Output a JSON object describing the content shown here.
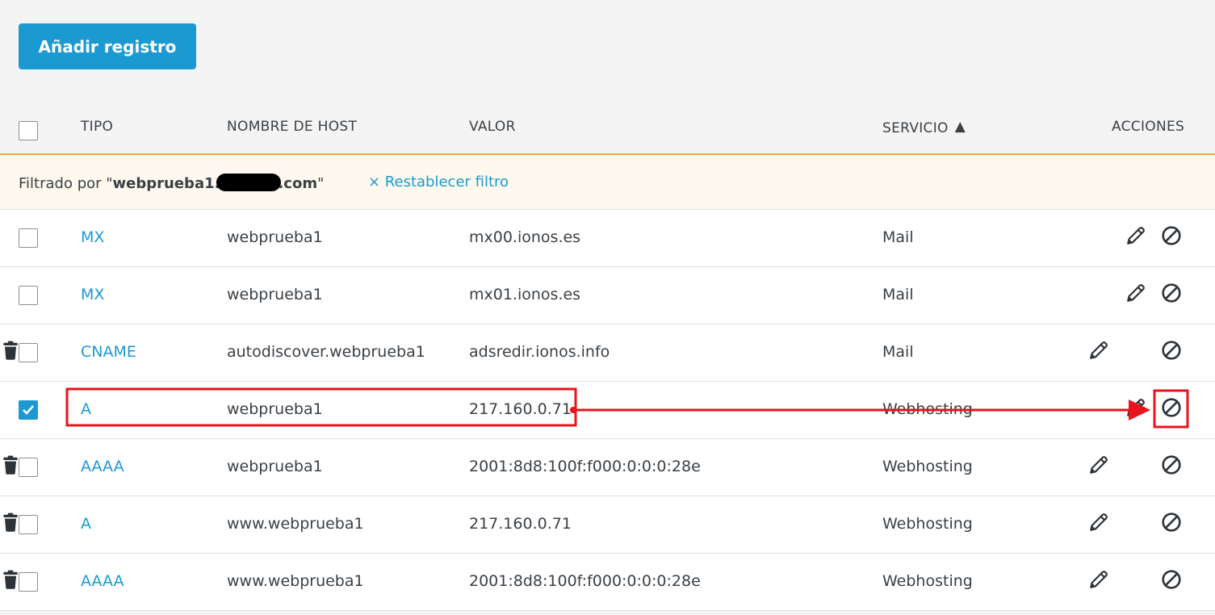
{
  "toolbar": {
    "add_label": "Añadir registro"
  },
  "table": {
    "headers": {
      "type": "TIPO",
      "host": "NOMBRE DE HOST",
      "value": "VALOR",
      "service": "SERVICIO",
      "service_sort_indicator": "▲",
      "actions": "ACCIONES"
    },
    "filter": {
      "prefix": "Filtrado por \"",
      "domain_start": "webprueba1.",
      "domain_end": ".com",
      "suffix": "\"",
      "reset_label": "× Restablecer filtro"
    },
    "rows": [
      {
        "checked": false,
        "type": "MX",
        "host": "webprueba1",
        "value": "mx00.ionos.es",
        "service": "Mail",
        "actions": [
          "edit",
          "disable"
        ]
      },
      {
        "checked": false,
        "type": "MX",
        "host": "webprueba1",
        "value": "mx01.ionos.es",
        "service": "Mail",
        "actions": [
          "edit",
          "disable"
        ]
      },
      {
        "checked": false,
        "type": "CNAME",
        "host": "autodiscover.webprueba1",
        "value": "adsredir.ionos.info",
        "service": "Mail",
        "actions": [
          "edit",
          "delete",
          "disable"
        ]
      },
      {
        "checked": true,
        "type": "A",
        "host": "webprueba1",
        "value": "217.160.0.71",
        "service": "Webhosting",
        "actions": [
          "edit",
          "disable"
        ]
      },
      {
        "checked": false,
        "type": "AAAA",
        "host": "webprueba1",
        "value": "2001:8d8:100f:f000:0:0:0:28e",
        "service": "Webhosting",
        "actions": [
          "edit",
          "delete",
          "disable"
        ]
      },
      {
        "checked": false,
        "type": "A",
        "host": "www.webprueba1",
        "value": "217.160.0.71",
        "service": "Webhosting",
        "actions": [
          "edit",
          "delete",
          "disable"
        ]
      },
      {
        "checked": false,
        "type": "AAAA",
        "host": "www.webprueba1",
        "value": "2001:8d8:100f:f000:0:0:0:28e",
        "service": "Webhosting",
        "actions": [
          "edit",
          "delete",
          "disable"
        ]
      }
    ]
  },
  "icons": {
    "edit": "pencil-icon",
    "delete": "trash-icon",
    "disable": "disable-icon",
    "checkbox_checked": "checkmark-icon"
  },
  "colors": {
    "accent": "#1b9ad1",
    "filter_background": "#fef8ee",
    "header_divider": "#f0a74a",
    "annotation": "#e8141c"
  }
}
